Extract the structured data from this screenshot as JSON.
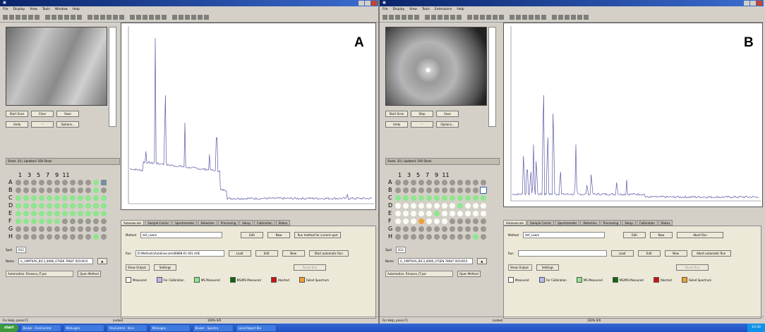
{
  "windows": [
    {
      "panel_letter": "A",
      "menu": [
        "File",
        "Display",
        "View",
        "Tools",
        "Window",
        "Help"
      ],
      "buttons": {
        "start_scan": "Start Scan",
        "clear": "Clear",
        "save": "Save",
        "undo": "Undo",
        "options": "Options..."
      },
      "strip_text": "Shots: 20 | Updated: 500 Shots",
      "plate": {
        "columns": [
          "1",
          "3",
          "5",
          "7",
          "9",
          "11"
        ],
        "rows": [
          {
            "label": "A",
            "wells": [
              "n",
              "n",
              "n",
              "n",
              "n",
              "n",
              "n",
              "n",
              "n",
              "n",
              "g",
              "dk"
            ]
          },
          {
            "label": "B",
            "wells": [
              "n",
              "n",
              "n",
              "n",
              "n",
              "n",
              "n",
              "n",
              "n",
              "n",
              "g",
              "n"
            ]
          },
          {
            "label": "C",
            "wells": [
              "g",
              "g",
              "g",
              "g",
              "g",
              "g",
              "g",
              "g",
              "g",
              "g",
              "g",
              "g"
            ]
          },
          {
            "label": "D",
            "wells": [
              "g",
              "g",
              "g",
              "g",
              "g",
              "g",
              "g",
              "g",
              "g",
              "g",
              "g",
              "g"
            ]
          },
          {
            "label": "E",
            "wells": [
              "g",
              "g",
              "g",
              "g",
              "g",
              "g",
              "g",
              "g",
              "g",
              "g",
              "g",
              "g"
            ]
          },
          {
            "label": "F",
            "wells": [
              "g",
              "g",
              "g",
              "g",
              "g",
              "g",
              "n",
              "n",
              "n",
              "n",
              "n",
              "n"
            ]
          },
          {
            "label": "G",
            "wells": [
              "n",
              "n",
              "n",
              "n",
              "n",
              "n",
              "n",
              "n",
              "n",
              "n",
              "n",
              "n"
            ]
          },
          {
            "label": "H",
            "wells": [
              "n",
              "n",
              "n",
              "n",
              "n",
              "n",
              "n",
              "n",
              "n",
              "n",
              "g",
              "n"
            ]
          }
        ]
      },
      "fields": {
        "spot_label": "Spot",
        "spot_value": "B12",
        "name_label": "Name",
        "name_value": "G_19MTKAS_BIC3_8086_07SEN 78687 0010010",
        "file_label": "Automation: Rmason_IT.par",
        "open_button": "Open Method"
      },
      "tabs": [
        "Autoexecute",
        "Sample Carrier",
        "Spectrometer",
        "Detection",
        "Processing",
        "Setup",
        "Calibration",
        "Status"
      ],
      "method_label": "Method",
      "method_value": "def_Lowm",
      "edit_label": "Edit",
      "new_label": "New",
      "run_button": "Run method for current spot",
      "run_label": "Run",
      "run_value": "D:\\Methods\\AutoExecute\\08888-01-001.AXE",
      "load_button": "Load",
      "start_run_button": "Start automatic Run",
      "show_output_label": "Show Output",
      "settings_button": "Settings",
      "pause_button": "Pause Run",
      "legend": [
        "Measured",
        "For Calibration",
        "MS Measured",
        "MS/MS Measured",
        "Aborted",
        "Failed Spectrum"
      ],
      "status_left": "For Help, press F1",
      "status_mid": "Locked",
      "status_right": "100% 0/0"
    },
    {
      "panel_letter": "B",
      "menu": [
        "File",
        "Display",
        "View",
        "Tools",
        "Extensions",
        "Help"
      ],
      "buttons": {
        "start_scan": "Start Scan",
        "clear": "Stop",
        "save": "Save",
        "undo": "Undo",
        "options": "Options..."
      },
      "strip_text": "Shots: 20 | Updated: 500 Shots",
      "plate": {
        "columns": [
          "1",
          "3",
          "5",
          "7",
          "9",
          "11"
        ],
        "rows": [
          {
            "label": "A",
            "wells": [
              "n",
              "n",
              "n",
              "n",
              "n",
              "n",
              "n",
              "n",
              "n",
              "n",
              "n",
              "n"
            ]
          },
          {
            "label": "B",
            "wells": [
              "n",
              "n",
              "n",
              "n",
              "n",
              "n",
              "n",
              "n",
              "n",
              "n",
              "n",
              "sel"
            ]
          },
          {
            "label": "C",
            "wells": [
              "g",
              "g",
              "g",
              "g",
              "g",
              "g",
              "g",
              "g",
              "g",
              "g",
              "g",
              "g"
            ]
          },
          {
            "label": "D",
            "wells": [
              "w",
              "w",
              "w",
              "w",
              "w",
              "w",
              "w",
              "w",
              "g",
              "w",
              "w",
              "w"
            ]
          },
          {
            "label": "E",
            "wells": [
              "w",
              "w",
              "w",
              "w",
              "w",
              "g",
              "w",
              "w",
              "w",
              "w",
              "w",
              "w"
            ]
          },
          {
            "label": "F",
            "wells": [
              "w",
              "w",
              "w",
              "o",
              "w",
              "w",
              "w",
              "n",
              "n",
              "n",
              "n",
              "n"
            ]
          },
          {
            "label": "G",
            "wells": [
              "n",
              "n",
              "n",
              "n",
              "n",
              "n",
              "n",
              "n",
              "n",
              "n",
              "n",
              "n"
            ]
          },
          {
            "label": "H",
            "wells": [
              "n",
              "n",
              "n",
              "n",
              "n",
              "n",
              "n",
              "n",
              "n",
              "n",
              "g",
              "n"
            ]
          }
        ]
      },
      "fields": {
        "spot_label": "Spot",
        "spot_value": "B12",
        "name_label": "Name",
        "name_value": "G_19MTKAS_BIC3_8086_07SEN 78687 0010010",
        "file_label": "Automation: Rmason_IT.par",
        "open_button": "Open Method"
      },
      "tabs": [
        "Autoexecute",
        "Sample Carrier",
        "Spectrometer",
        "Detection",
        "Processing",
        "Setup",
        "Calibration",
        "Status"
      ],
      "method_label": "Method",
      "method_value": "def_Lowm",
      "edit_label": "Edit",
      "new_label": "New",
      "run_button": "Abort Run",
      "run_label": "Run",
      "run_value": "",
      "load_button": "Load",
      "start_run_button": "Abort automatic Run",
      "show_output_label": "Show Output",
      "settings_button": "Settings",
      "pause_button": "Pause Run",
      "legend": [
        "Measured",
        "For Calibration",
        "MS Measured",
        "MS/MS Measured",
        "Aborted",
        "Failed Spectrum"
      ],
      "status_left": "For Help, press F1",
      "status_mid": "Locked",
      "status_right": "100% 0/0"
    }
  ],
  "colors": {
    "spectrum": "#5a5aa8",
    "well_empty": "#9a9890",
    "well_green": "#8ee68e",
    "legend": [
      "#ffffff",
      "#b8b8f0",
      "#8ee68e",
      "#0a6a0a",
      "#d01010",
      "#f0a030"
    ]
  },
  "taskbar": {
    "start_label": "start",
    "tasks": [
      "Bruker - FlexControl",
      "WinLogon",
      "FlexControl - Brvs",
      "WinLogon",
      "Bruker - Spectra",
      "Local Report Bio"
    ],
    "clock": "10:34"
  }
}
